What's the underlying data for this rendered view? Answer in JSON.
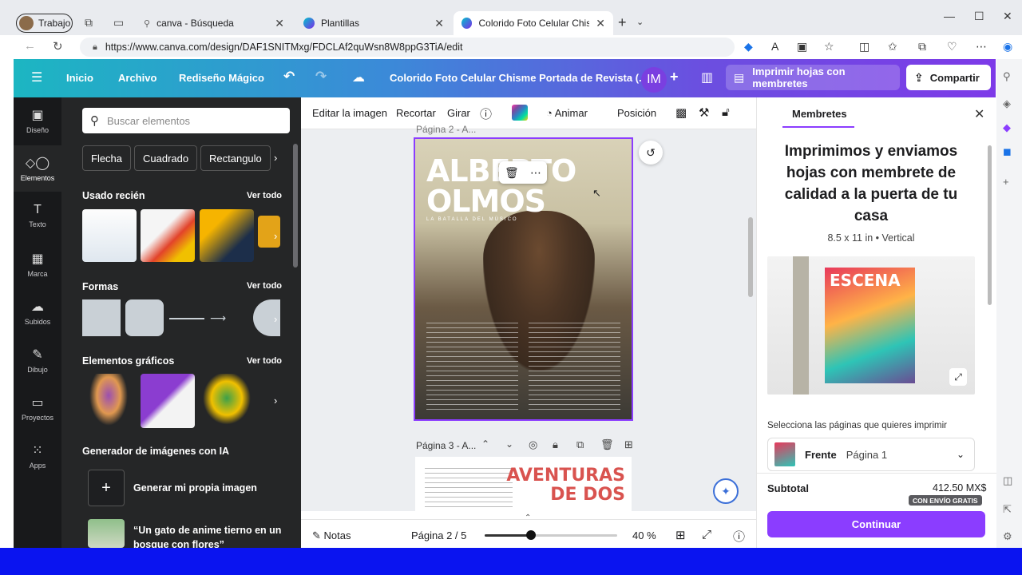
{
  "browser": {
    "profile_label": "Trabajo",
    "tabs": [
      {
        "label": "canva - Búsqueda"
      },
      {
        "label": "Plantillas"
      },
      {
        "label": "Colorido Foto Celular Chisme Po"
      }
    ],
    "url": "https://www.canva.com/design/DAF1SNITMxg/FDCLAf2quWsn8W8ppG3TiA/edit"
  },
  "topbar": {
    "home": "Inicio",
    "file": "Archivo",
    "magic": "Rediseño Mágico",
    "doc_title": "Colorido Foto Celular Chisme Portada de Revista (...",
    "avatar_initials": "IM",
    "print_label": "Imprimir hojas con membretes",
    "share_label": "Compartir"
  },
  "rail": [
    {
      "label": "Diseño"
    },
    {
      "label": "Elementos"
    },
    {
      "label": "Texto"
    },
    {
      "label": "Marca"
    },
    {
      "label": "Subidos"
    },
    {
      "label": "Dibujo"
    },
    {
      "label": "Proyectos"
    },
    {
      "label": "Apps"
    }
  ],
  "elements_panel": {
    "search_placeholder": "Buscar elementos",
    "chips": [
      "Flecha",
      "Cuadrado",
      "Rectangulo"
    ],
    "recent_title": "Usado recién",
    "shapes_title": "Formas",
    "graphics_title": "Elementos gráficos",
    "see_all": "Ver todo",
    "ai_title": "Generador de imágenes con IA",
    "ai_generate": "Generar mi propia imagen",
    "ai_prompt": "“Un gato de anime tierno en un bosque con flores”"
  },
  "toolbar": {
    "edit_image": "Editar la imagen",
    "crop": "Recortar",
    "rotate": "Girar",
    "animate": "Animar",
    "position": "Posición"
  },
  "canvas": {
    "page2_label": "Página 2 - A...",
    "page3_label": "Página 3 - A...",
    "mag_title_1": "ALBERTO",
    "mag_title_2": "OLMOS",
    "mag_sub": "LA BATALLA DEL MÚSICO",
    "page3_title_1": "AVENTURAS",
    "page3_title_2": "DE DOS"
  },
  "bottombar": {
    "notes": "Notas",
    "page_indicator": "Página 2 / 5",
    "zoom": "40 %",
    "zoom_fraction": 0.35
  },
  "print_panel": {
    "tab": "Membretes",
    "heading": "Imprimimos y enviamos hojas con membrete de calidad a la puerta de tu casa",
    "spec": "8.5 x 11 in • Vertical",
    "mag_name": "ESCENA",
    "select_label": "Selecciona las páginas que quieres imprimir",
    "side": "Frente",
    "page": "Página 1",
    "subtotal_label": "Subtotal",
    "subtotal_value": "412.50 MX$",
    "shipping_badge": "CON ENVÍO GRATIS",
    "continue_label": "Continuar"
  },
  "colors": {
    "accent": "#8b3dff",
    "panel_dark": "#252627",
    "taskbar": "#0a14f0"
  }
}
